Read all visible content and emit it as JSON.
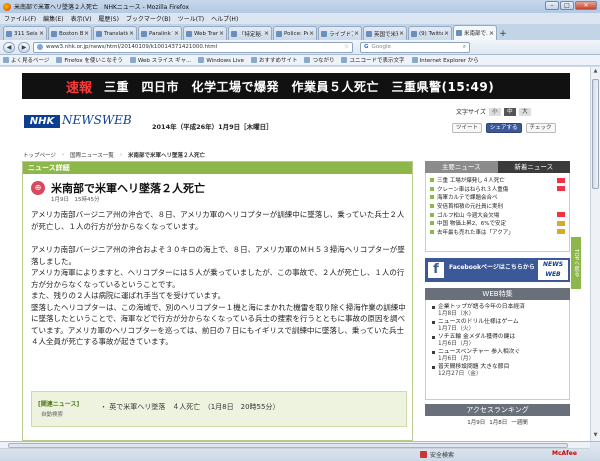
{
  "window": {
    "title": "米南部で米軍ヘリ墜落２人死亡　NHKニュース - Mozilla Firefox"
  },
  "menu": [
    "ファイル(F)",
    "編集(E)",
    "表示(V)",
    "履歴(S)",
    "ブックマーク(B)",
    "ツール(T)",
    "ヘルプ(H)"
  ],
  "tabs": [
    {
      "label": "311 Seism..."
    },
    {
      "label": "Boston Ba..."
    },
    {
      "label": "Translatio..."
    },
    {
      "label": "Paralink T..."
    },
    {
      "label": "Web Tran..."
    },
    {
      "label": "「特定秘..."
    },
    {
      "label": "Police: Pe..."
    },
    {
      "label": "ライブドア..."
    },
    {
      "label": "英国で米軍..."
    },
    {
      "label": "(9) Twitter"
    },
    {
      "label": "米南部で..."
    }
  ],
  "nav": {
    "back": "◀",
    "forward": "▶",
    "url": "www3.nhk.or.jp/news/html/20140109/k10014371421000.html",
    "search_placeholder": "Google"
  },
  "bookmarks": [
    "よく見るページ",
    "Firefox を使いこなそう",
    "Web スライス ギャ...",
    "Windows Live",
    "おすすめサイト",
    "つながり",
    "ユニコードで表示文字",
    "Internet Explorer から"
  ],
  "breaking": {
    "label": "速報",
    "text": "三重　四日市　化学工場で爆発　作業員５人死亡　三重県警(15:49)"
  },
  "header": {
    "logo_nhk": "NHK",
    "logo_news": "NEWSWEB",
    "date": "2014年（平成26年）1月9日［木曜日］",
    "textsize_label": "文字サイズ",
    "textsize_options": [
      "小",
      "中",
      "大"
    ],
    "social": [
      "ツイート",
      "シェアする",
      "チェック"
    ]
  },
  "breadcrumb": [
    "トップページ",
    "国際ニュース一覧",
    "米南部で米軍ヘリ墜落２人死亡"
  ],
  "article": {
    "section": "ニュース詳細",
    "title": "米南部で米軍ヘリ墜落２人死亡",
    "date": "1月9日　15時45分",
    "lead": "アメリカ南部バージニア州の沖合で、８日、アメリカ軍のヘリコプターが訓練中に墜落し、乗っていた兵士２人が死亡し、１人の行方が分からなくなっています。",
    "body": [
      "アメリカ南部バージニア州の沖合およそ３０キロの海上で、８日、アメリカ軍のＭＨ５３掃海ヘリコプターが墜落しました。",
      "アメリカ海軍によりますと、ヘリコプターには５人が乗っていましたが、この事故で、２人が死亡し、１人の行方が分からなくなっているということです。",
      "また、残りの２人は病院に運ばれ手当てを受けています。",
      "墜落したヘリコプターは、この海域で、別のヘリコプター１機と海にまかれた機雷を取り除く掃海作業の訓練中に墜落したということで、海軍などで行方が分からなくなっている兵士の捜索を行うとともに事故の原因を調べています。アメリカ軍のヘリコプターを巡っては、前日の７日にもイギリスで訓練中に墜落し、乗っていた兵士４人全員が死亡する事故が起きています。"
    ],
    "related_label": "[関連ニュース]",
    "related_sub": "自動検索",
    "related_item": "・ 英で米軍ヘリ墜落　４人死亡　（1月8日　20時55分）"
  },
  "sidebar": {
    "tabs": [
      "主要ニュース",
      "新着ニュース"
    ],
    "news": [
      {
        "text": "三重 工場が爆発し４人死亡",
        "icon": "new"
      },
      {
        "text": "クレーン車はねられ３人重傷",
        "icon": "new"
      },
      {
        "text": "海軍カルテで課題会合ペ",
        "icon": "none"
      },
      {
        "text": "安倍首相積の元社員に実刑",
        "icon": "none"
      },
      {
        "text": "ゴルフ松山 今週大会欠場",
        "icon": "new"
      },
      {
        "text": "中国 物価上昇2、6%で安定",
        "icon": "photo"
      },
      {
        "text": "去年最も売れた車は「アクア」",
        "icon": "photo"
      }
    ],
    "fb_text": "Facebookページはこちらから",
    "fb_logo": "NEWS WEB",
    "web_head": "WEB特集",
    "web_items": [
      {
        "title": "企業トップが語る今年の日本経済",
        "date": "1月8日（水）"
      },
      {
        "title": "ニュースのドリル仕様はゲーム",
        "date": "1月7日（火）"
      },
      {
        "title": "ソチ五輪 金メダル獲得の鍵は",
        "date": "1月6日（月）"
      },
      {
        "title": "ニュースベンチャー 参入相次ぐ",
        "date": "1月6日（月）"
      },
      {
        "title": "普天間移設問題 大きな節目",
        "date": "12月27日（金）"
      }
    ],
    "rank_head": "アクセスランキング",
    "rank_tabs": [
      "1月9日",
      "1月8日",
      "一週間"
    ]
  },
  "topbtn": "TOPへ戻る",
  "status": {
    "security": "安全検索",
    "mcafee": "McAfee"
  }
}
